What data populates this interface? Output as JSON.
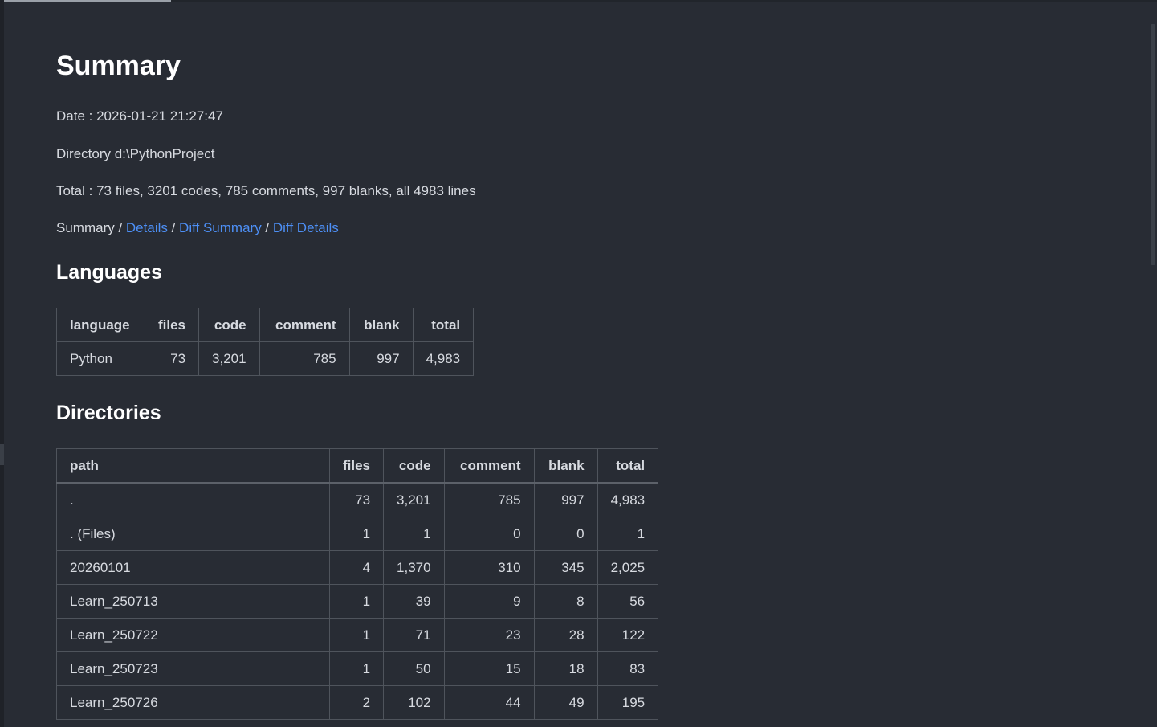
{
  "title": "Summary",
  "date_line": "Date : 2026-01-21 21:27:47",
  "directory_line": "Directory d:\\PythonProject",
  "total_line": "Total : 73 files, 3201 codes, 785 comments, 997 blanks, all 4983 lines",
  "nav": {
    "current": "Summary",
    "separator": " / ",
    "links": [
      "Details",
      "Diff Summary",
      "Diff Details"
    ]
  },
  "languages": {
    "heading": "Languages",
    "columns": [
      "language",
      "files",
      "code",
      "comment",
      "blank",
      "total"
    ],
    "rows": [
      [
        "Python",
        "73",
        "3,201",
        "785",
        "997",
        "4,983"
      ]
    ]
  },
  "directories": {
    "heading": "Directories",
    "columns": [
      "path",
      "files",
      "code",
      "comment",
      "blank",
      "total"
    ],
    "rows": [
      [
        ".",
        "73",
        "3,201",
        "785",
        "997",
        "4,983"
      ],
      [
        ". (Files)",
        "1",
        "1",
        "0",
        "0",
        "1"
      ],
      [
        "20260101",
        "4",
        "1,370",
        "310",
        "345",
        "2,025"
      ],
      [
        "Learn_250713",
        "1",
        "39",
        "9",
        "8",
        "56"
      ],
      [
        "Learn_250722",
        "1",
        "71",
        "23",
        "28",
        "122"
      ],
      [
        "Learn_250723",
        "1",
        "50",
        "15",
        "18",
        "83"
      ],
      [
        "Learn_250726",
        "2",
        "102",
        "44",
        "49",
        "195"
      ]
    ]
  }
}
